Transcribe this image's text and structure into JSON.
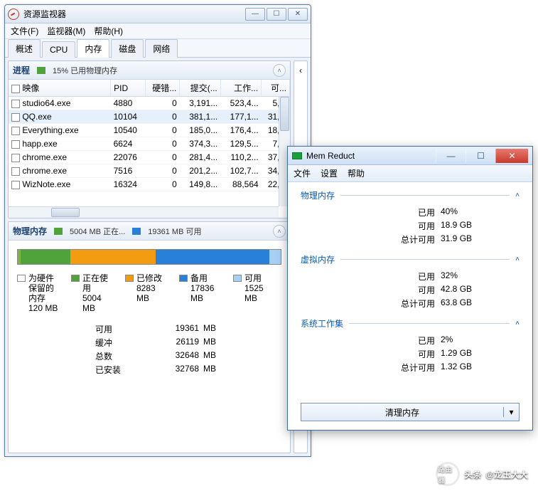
{
  "rm": {
    "title": "资源监视器",
    "menu": {
      "file": "文件(F)",
      "monitor": "监视器(M)",
      "help": "帮助(H)"
    },
    "tabs": [
      "概述",
      "CPU",
      "内存",
      "磁盘",
      "网络"
    ],
    "proc": {
      "title": "进程",
      "usage_text": "15% 已用物理内存",
      "cols": {
        "image": "映像",
        "pid": "PID",
        "hard": "硬错...",
        "commit": "提交(...",
        "ws": "工作...",
        "share": "可..."
      },
      "rows": [
        {
          "name": "studio64.exe",
          "pid": "4880",
          "hard": "0",
          "commit": "3,191...",
          "ws": "523,4...",
          "share": "5,..."
        },
        {
          "name": "QQ.exe",
          "pid": "10104",
          "hard": "0",
          "commit": "381,1...",
          "ws": "177,1...",
          "share": "31,...",
          "sel": true
        },
        {
          "name": "Everything.exe",
          "pid": "10540",
          "hard": "0",
          "commit": "185,0...",
          "ws": "176,4...",
          "share": "18,..."
        },
        {
          "name": "happ.exe",
          "pid": "6624",
          "hard": "0",
          "commit": "374,3...",
          "ws": "129,5...",
          "share": "7,..."
        },
        {
          "name": "chrome.exe",
          "pid": "22076",
          "hard": "0",
          "commit": "281,4...",
          "ws": "110,2...",
          "share": "37,..."
        },
        {
          "name": "chrome.exe",
          "pid": "7516",
          "hard": "0",
          "commit": "201,2...",
          "ws": "102,7...",
          "share": "34,..."
        },
        {
          "name": "WizNote.exe",
          "pid": "16324",
          "hard": "0",
          "commit": "149,8...",
          "ws": "88,564",
          "share": "22,..."
        }
      ]
    },
    "mem": {
      "title": "物理内存",
      "chip1_text": "5004 MB 正在...",
      "chip2_text": "19361 MB 可用",
      "legend": [
        {
          "color": "#ffffff",
          "label": "为硬件保留的内存",
          "val": "120 MB"
        },
        {
          "color": "#4fa33a",
          "label": "正在使用",
          "val": "5004 MB"
        },
        {
          "color": "#f39c12",
          "label": "已修改",
          "val": "8283 MB"
        },
        {
          "color": "#2980d9",
          "label": "备用",
          "val": "17836 MB"
        },
        {
          "color": "#a8d0f5",
          "label": "可用",
          "val": "1525 MB"
        }
      ],
      "stats": [
        {
          "k": "可用",
          "v": "19361",
          "u": "MB"
        },
        {
          "k": "缓冲",
          "v": "26119",
          "u": "MB"
        },
        {
          "k": "总数",
          "v": "32648",
          "u": "MB"
        },
        {
          "k": "已安装",
          "v": "32768",
          "u": "MB"
        }
      ]
    }
  },
  "mr": {
    "title": "Mem Reduct",
    "menu": {
      "file": "文件",
      "settings": "设置",
      "help": "帮助"
    },
    "sections": [
      {
        "title": "物理内存",
        "rows": [
          {
            "k": "已用",
            "v": "40%"
          },
          {
            "k": "可用",
            "v": "18.9 GB"
          },
          {
            "k": "总计可用",
            "v": "31.9 GB"
          }
        ]
      },
      {
        "title": "虚拟内存",
        "rows": [
          {
            "k": "已用",
            "v": "32%"
          },
          {
            "k": "可用",
            "v": "42.8 GB"
          },
          {
            "k": "总计可用",
            "v": "63.8 GB"
          }
        ]
      },
      {
        "title": "系统工作集",
        "rows": [
          {
            "k": "已用",
            "v": "2%"
          },
          {
            "k": "可用",
            "v": "1.29 GB"
          },
          {
            "k": "总计可用",
            "v": "1.32 GB"
          }
        ]
      }
    ],
    "clean_btn": "清理内存"
  },
  "watermark": {
    "prefix": "头条",
    "handle": "@龙玉大大",
    "icon": "路由器"
  }
}
